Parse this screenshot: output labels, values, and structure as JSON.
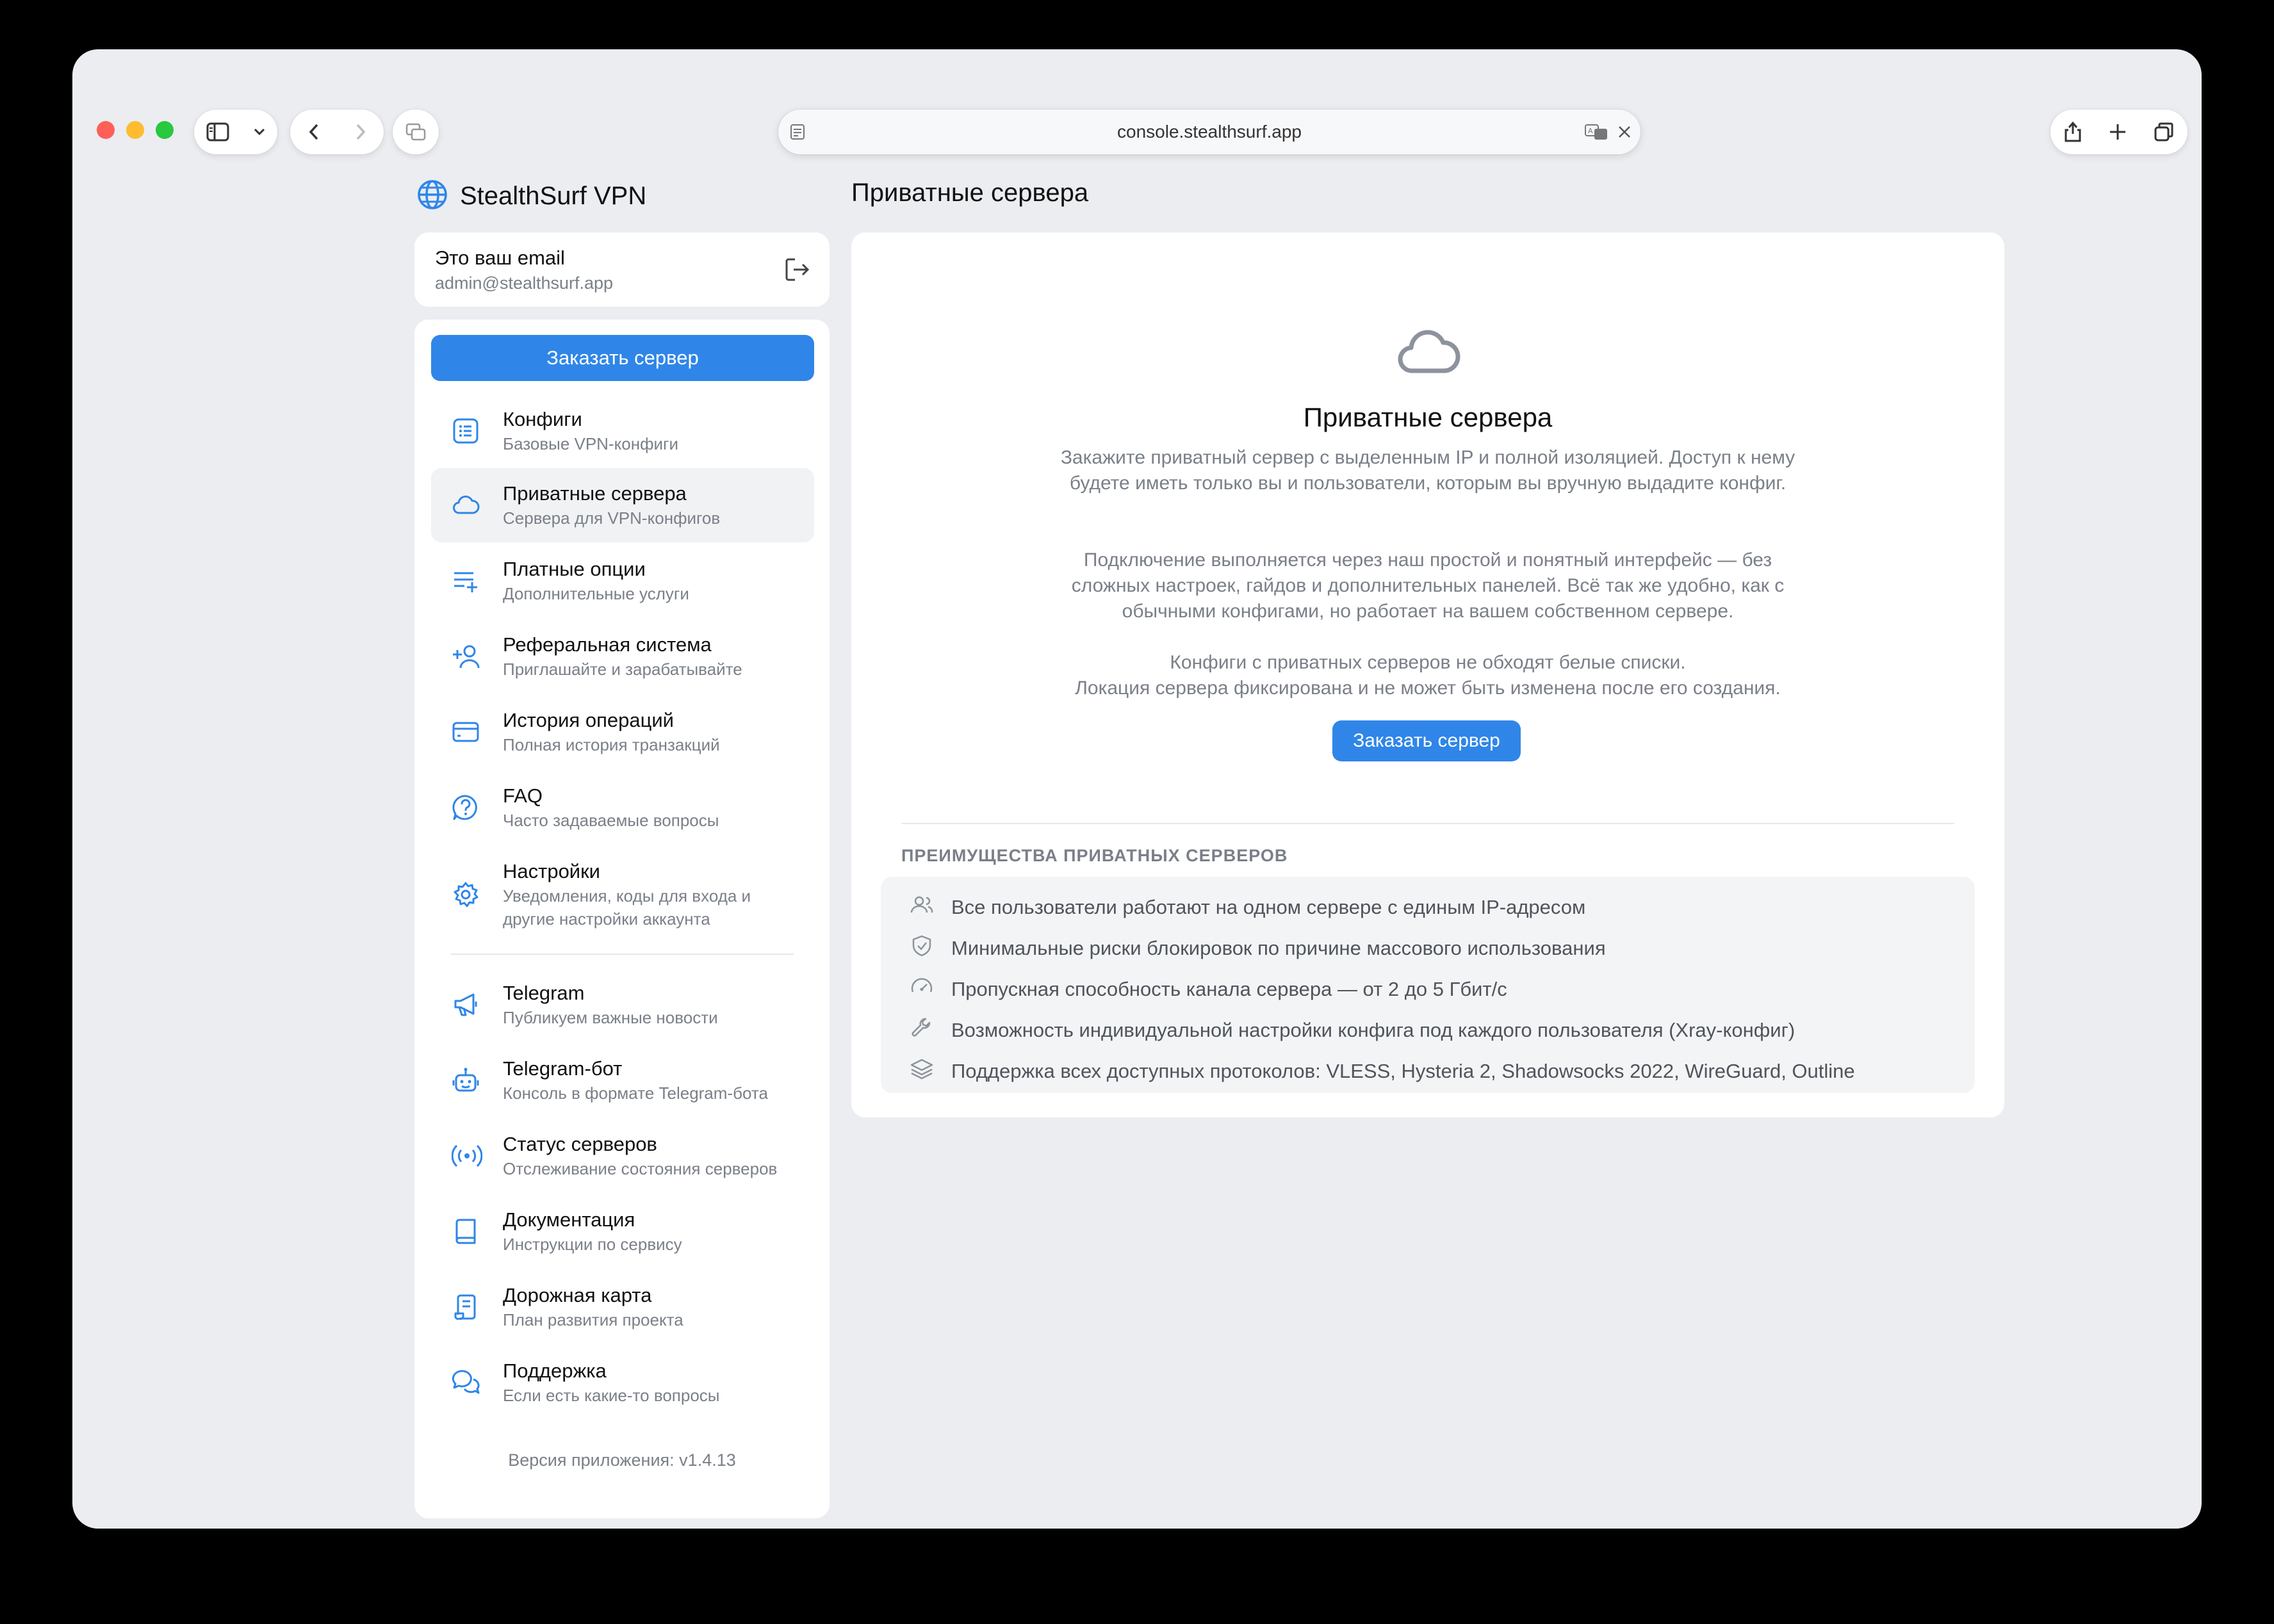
{
  "browser": {
    "url": "console.stealthsurf.app"
  },
  "brand": {
    "name": "StealthSurf VPN"
  },
  "account": {
    "label": "Это ваш email",
    "email": "admin@stealthsurf.app"
  },
  "sidebar": {
    "order_button": "Заказать сервер",
    "items": [
      {
        "title": "Конфиги",
        "subtitle": "Базовые VPN-конфиги",
        "icon": "list-icon"
      },
      {
        "title": "Приватные сервера",
        "subtitle": "Сервера для VPN-конфигов",
        "icon": "cloud-icon",
        "active": true
      },
      {
        "title": "Платные опции",
        "subtitle": "Дополнительные услуги",
        "icon": "list-plus-icon"
      },
      {
        "title": "Реферальная система",
        "subtitle": "Приглашайте и зарабатывайте",
        "icon": "user-plus-icon"
      },
      {
        "title": "История операций",
        "subtitle": "Полная история транзакций",
        "icon": "credit-card-icon"
      },
      {
        "title": "FAQ",
        "subtitle": "Часто задаваемые вопросы",
        "icon": "help-circle-icon"
      },
      {
        "title": "Настройки",
        "subtitle": "Уведомления, коды для входа и другие настройки аккаунта",
        "icon": "gear-icon"
      },
      {
        "title": "Telegram",
        "subtitle": "Публикуем важные новости",
        "icon": "megaphone-icon"
      },
      {
        "title": "Telegram-бот",
        "subtitle": "Консоль в формате Telegram-бота",
        "icon": "bot-icon"
      },
      {
        "title": "Статус серверов",
        "subtitle": "Отслеживание состояния серверов",
        "icon": "broadcast-icon"
      },
      {
        "title": "Документация",
        "subtitle": "Инструкции по сервису",
        "icon": "book-icon"
      },
      {
        "title": "Дорожная карта",
        "subtitle": "План развития проекта",
        "icon": "scroll-icon"
      },
      {
        "title": "Поддержка",
        "subtitle": "Если есть какие-то вопросы",
        "icon": "chat-icon"
      }
    ],
    "version": "Версия приложения: v1.4.13"
  },
  "main": {
    "page_title": "Приватные сервера",
    "hero_title": "Приватные сервера",
    "paragraphs": [
      "Закажите приватный сервер с выделенным IP и полной изоляцией. Доступ к нему будете иметь только вы и пользователи, которым вы вручную выдадите конфиг.",
      "Подключение выполняется через наш простой и понятный интерфейс — без сложных настроек, гайдов и дополнительных панелей. Всё так же удобно, как с обычными конфигами, но работает на вашем собственном сервере.",
      "Конфиги с приватных серверов не обходят белые списки.",
      "Локация сервера фиксирована и не может быть изменена после его создания."
    ],
    "order_button": "Заказать сервер",
    "advantages_heading": "ПРЕИМУЩЕСТВА ПРИВАТНЫХ СЕРВЕРОВ",
    "advantages": [
      {
        "text": "Все пользователи работают на одном сервере с единым IP-адресом",
        "icon": "users-icon"
      },
      {
        "text": "Минимальные риски блокировок по причине массового использования",
        "icon": "shield-check-icon"
      },
      {
        "text": "Пропускная способность канала сервера — от 2 до 5 Гбит/с",
        "icon": "gauge-icon"
      },
      {
        "text": "Возможность индивидуальной настройки конфига под каждого пользователя (Xray-конфиг)",
        "icon": "wrench-icon"
      },
      {
        "text": "Поддержка всех доступных протоколов: VLESS, Hysteria 2, Shadowsocks 2022, WireGuard, Outline",
        "icon": "layers-icon"
      }
    ]
  },
  "colors": {
    "accent": "#2f86e8",
    "window_bg": "#ebedf1"
  }
}
